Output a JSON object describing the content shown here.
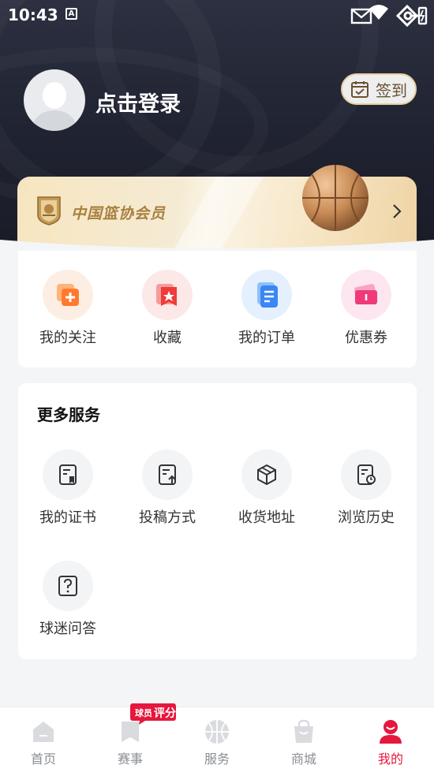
{
  "status_bar": {
    "time": "10:43",
    "notification_glyph": "A",
    "icons": [
      "keyboard-icon",
      "mail-icon",
      "wifi-icon",
      "vpn-key-icon",
      "battery-icon"
    ]
  },
  "profile": {
    "login_text": "点击登录",
    "checkin_label": "签到"
  },
  "member": {
    "text": "中国篮协会员"
  },
  "quick_actions": [
    {
      "label": "我的关注",
      "icon": "follow-icon",
      "color": "#ff8a3d"
    },
    {
      "label": "收藏",
      "icon": "favorite-icon",
      "color": "#f04848"
    },
    {
      "label": "我的订单",
      "icon": "order-icon",
      "color": "#3f8cf4"
    },
    {
      "label": "优惠券",
      "icon": "coupon-icon",
      "color": "#f2467e"
    }
  ],
  "more_services": {
    "title": "更多服务",
    "items": [
      {
        "label": "我的证书",
        "icon": "certificate-icon"
      },
      {
        "label": "投稿方式",
        "icon": "submit-icon"
      },
      {
        "label": "收货地址",
        "icon": "box-icon"
      },
      {
        "label": "浏览历史",
        "icon": "history-icon"
      },
      {
        "label": "球迷问答",
        "icon": "question-icon"
      }
    ]
  },
  "bottom_nav": {
    "items": [
      {
        "label": "首页",
        "icon": "home-icon",
        "active": false
      },
      {
        "label": "赛事",
        "icon": "match-icon",
        "active": false
      },
      {
        "label": "服务",
        "icon": "basketball-icon",
        "active": false
      },
      {
        "label": "商城",
        "icon": "shop-bag-icon",
        "active": false
      },
      {
        "label": "我的",
        "icon": "profile-icon",
        "active": true
      }
    ],
    "badge_line1": "球员",
    "badge_line2": "评分"
  },
  "colors": {
    "accent": "#e5173d",
    "header_bg": "#1f2230",
    "gold": "#a8803f"
  }
}
